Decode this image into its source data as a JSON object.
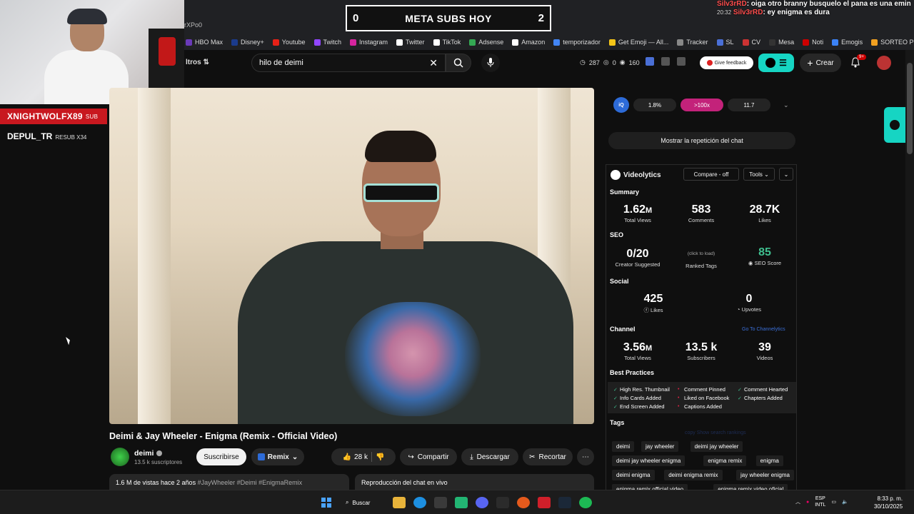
{
  "stream": {
    "subs_goal": {
      "left": "0",
      "title": "META SUBS HOY",
      "right": "2"
    },
    "sub_alert": {
      "name": "XNIGHTWOLFX89",
      "tag": "SUB"
    },
    "resub": {
      "name": "DEPUL_TR",
      "tag": "RESUB X34"
    },
    "chat": [
      {
        "time": "",
        "user": "Silv3rRD",
        "text": ": oiga otro branny busquelo el pana es una eminencia yo oigo gente que no suenan"
      },
      {
        "time": "20:32",
        "user": "Silv3rRD",
        "text": ": ey enigma es dura"
      }
    ]
  },
  "browser": {
    "tab_text": "rXPo0",
    "bookmarks": [
      {
        "label": "HBO Max",
        "color": "#6a3ab8"
      },
      {
        "label": "Disney+",
        "color": "#1b3b8c"
      },
      {
        "label": "Youtube",
        "color": "#e62117"
      },
      {
        "label": "Twitch",
        "color": "#9146ff"
      },
      {
        "label": "Instagram",
        "color": "#d6249f"
      },
      {
        "label": "Twitter",
        "color": "#ffffff"
      },
      {
        "label": "TikTok",
        "color": "#ffffff"
      },
      {
        "label": "Adsense",
        "color": "#34a853"
      },
      {
        "label": "Amazon",
        "color": "#ffffff"
      },
      {
        "label": "temporizador",
        "color": "#4285f4"
      },
      {
        "label": "Get Emoji — All...",
        "color": "#f5c518"
      },
      {
        "label": "Tracker",
        "color": "#888888"
      },
      {
        "label": "SL",
        "color": "#4a6fd6"
      },
      {
        "label": "CV",
        "color": "#cc3333"
      },
      {
        "label": "Mesa",
        "color": "#333333"
      },
      {
        "label": "Noti",
        "color": "#cc0000"
      },
      {
        "label": "Emogis",
        "color": "#3b82f6"
      },
      {
        "label": "SORTEO PICKER",
        "color": "#f0a020"
      }
    ]
  },
  "header": {
    "filters_label": "ltros",
    "search_value": "hilo de deimi",
    "stats": {
      "views": "287",
      "zero": "0",
      "count": "160"
    },
    "feedback_label": "Give feedback",
    "create_label": "Crear",
    "notif_badge": "9+"
  },
  "video": {
    "title": "Deimi & Jay Wheeler - Enigma (Remix - Official Video)",
    "channel": "deimi",
    "subscribers": "13.5 k suscriptores",
    "subscribe_label": "Suscribirse",
    "remix_label": "Remix",
    "likes": "28 k",
    "share_label": "Compartir",
    "download_label": "Descargar",
    "clip_label": "Recortar",
    "desc_stats": "1.6 M de vistas  hace 2 años",
    "desc_tags": "#JayWheeler #Deimi #EnigmaRemix",
    "chat_replay_title": "Reproducción del chat en vivo"
  },
  "extension": {
    "pills": [
      "1.8%",
      ">100x",
      "11.7"
    ],
    "chat_replay_button": "Mostrar la repetición del chat"
  },
  "videolytics": {
    "title": "Videolytics",
    "compare": "Compare - off",
    "tools": "Tools",
    "summary_label": "Summary",
    "summary": [
      {
        "value": "1.62",
        "unit": "M",
        "label": "Total Views"
      },
      {
        "value": "583",
        "unit": "",
        "label": "Comments"
      },
      {
        "value": "28.7K",
        "unit": "",
        "label": "Likes"
      }
    ],
    "seo_label": "SEO",
    "seo": [
      {
        "value": "0/20",
        "label": "Creator Suggested"
      },
      {
        "value": "(click to load)",
        "label": "Ranked Tags"
      },
      {
        "value": "85",
        "label": "SEO Score"
      }
    ],
    "social_label": "Social",
    "social": [
      {
        "value": "425",
        "label": "Likes"
      },
      {
        "value": "0",
        "label": "Upvotes"
      }
    ],
    "channel_label": "Channel",
    "channel_link": "Go To Channelytics",
    "channel": [
      {
        "value": "3.56",
        "unit": "M",
        "label": "Total Views"
      },
      {
        "value": "13.5 k",
        "unit": "",
        "label": "Subscribers"
      },
      {
        "value": "39",
        "unit": "",
        "label": "Videos"
      }
    ],
    "best_practices_label": "Best Practices",
    "best_practices": [
      {
        "label": "High Res. Thumbnail",
        "ok": true
      },
      {
        "label": "Comment Pinned",
        "ok": false
      },
      {
        "label": "Comment Hearted",
        "ok": true
      },
      {
        "label": "Info Cards Added",
        "ok": true
      },
      {
        "label": "Liked on Facebook",
        "ok": false
      },
      {
        "label": "Chapters Added",
        "ok": true
      },
      {
        "label": "End Screen Added",
        "ok": true
      },
      {
        "label": "Captions Added",
        "ok": false
      }
    ],
    "tags_label": "Tags",
    "tag_tools": "copy   Show search rankings",
    "tags": [
      "deimi",
      "jay wheeler",
      "deimi jay wheeler",
      "deimi jay wheeler enigma",
      "enigma remix",
      "enigma",
      "deimi enigma",
      "deimi enigma remix",
      "jay wheeler enigma",
      "enigma remix official video",
      "enigma remix video oficial"
    ]
  },
  "taskbar": {
    "search_label": "Buscar",
    "lang": "ESP",
    "layout": "INTL",
    "time": "8:33 p. m.",
    "date": "30/10/2025"
  }
}
